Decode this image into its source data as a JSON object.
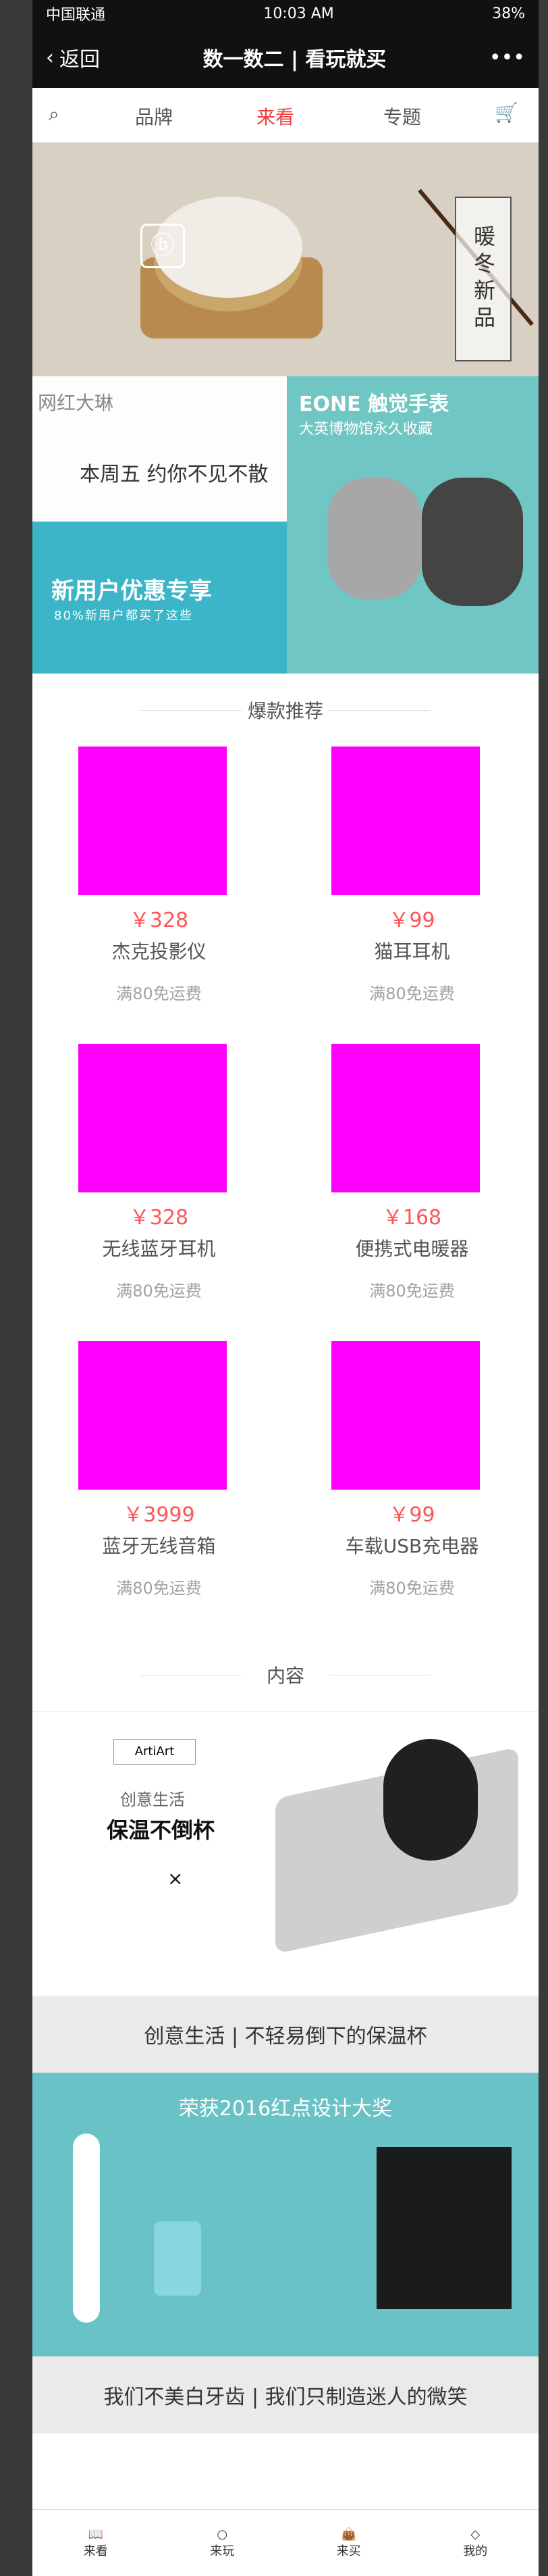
{
  "status": {
    "carrier": "中国联通",
    "time": "10:03 AM",
    "battery": "38%"
  },
  "nav": {
    "back": "返回",
    "title": "数一数二 | 看玩就买",
    "more": "•••"
  },
  "tabs": [
    {
      "label": "品牌"
    },
    {
      "label": "来看"
    },
    {
      "label": "专题"
    }
  ],
  "hero": {
    "vertical_text": "暖冬新品"
  },
  "promo": {
    "left_top_title": "网红大琳",
    "left_top_sub": "本周五 约你不见不散",
    "left_bottom_title": "新用户优惠专享",
    "left_bottom_sub": "80%新用户都买了这些",
    "right_title": "EONE 触觉手表",
    "right_sub": "大英博物馆永久收藏"
  },
  "section1": {
    "title": "爆款推荐"
  },
  "products": [
    {
      "price": "￥328",
      "name": "杰克投影仪",
      "ship": "满80免运费"
    },
    {
      "price": "￥99",
      "name": "猫耳耳机",
      "ship": "满80免运费"
    },
    {
      "price": "￥328",
      "name": "无线蓝牙耳机",
      "ship": "满80免运费"
    },
    {
      "price": "￥168",
      "name": "便携式电暖器",
      "ship": "满80免运费"
    },
    {
      "price": "￥3999",
      "name": "蓝牙无线音箱",
      "ship": "满80免运费"
    },
    {
      "price": "￥99",
      "name": "车载USB充电器",
      "ship": "满80免运费"
    }
  ],
  "section2": {
    "title": "内容"
  },
  "banner2": {
    "brand": "ArtiArt",
    "line1": "创意生活",
    "line2": "保温不倒杯",
    "times": "×"
  },
  "caption1": "创意生活 | 不轻易倒下的保温杯",
  "banner3": {
    "title": "荣获2016红点设计大奖"
  },
  "caption2": "我们不美白牙齿 | 我们只制造迷人的微笑",
  "bottom_nav": [
    {
      "label": "来看"
    },
    {
      "label": "来玩"
    },
    {
      "label": "来买"
    },
    {
      "label": "我的"
    }
  ]
}
